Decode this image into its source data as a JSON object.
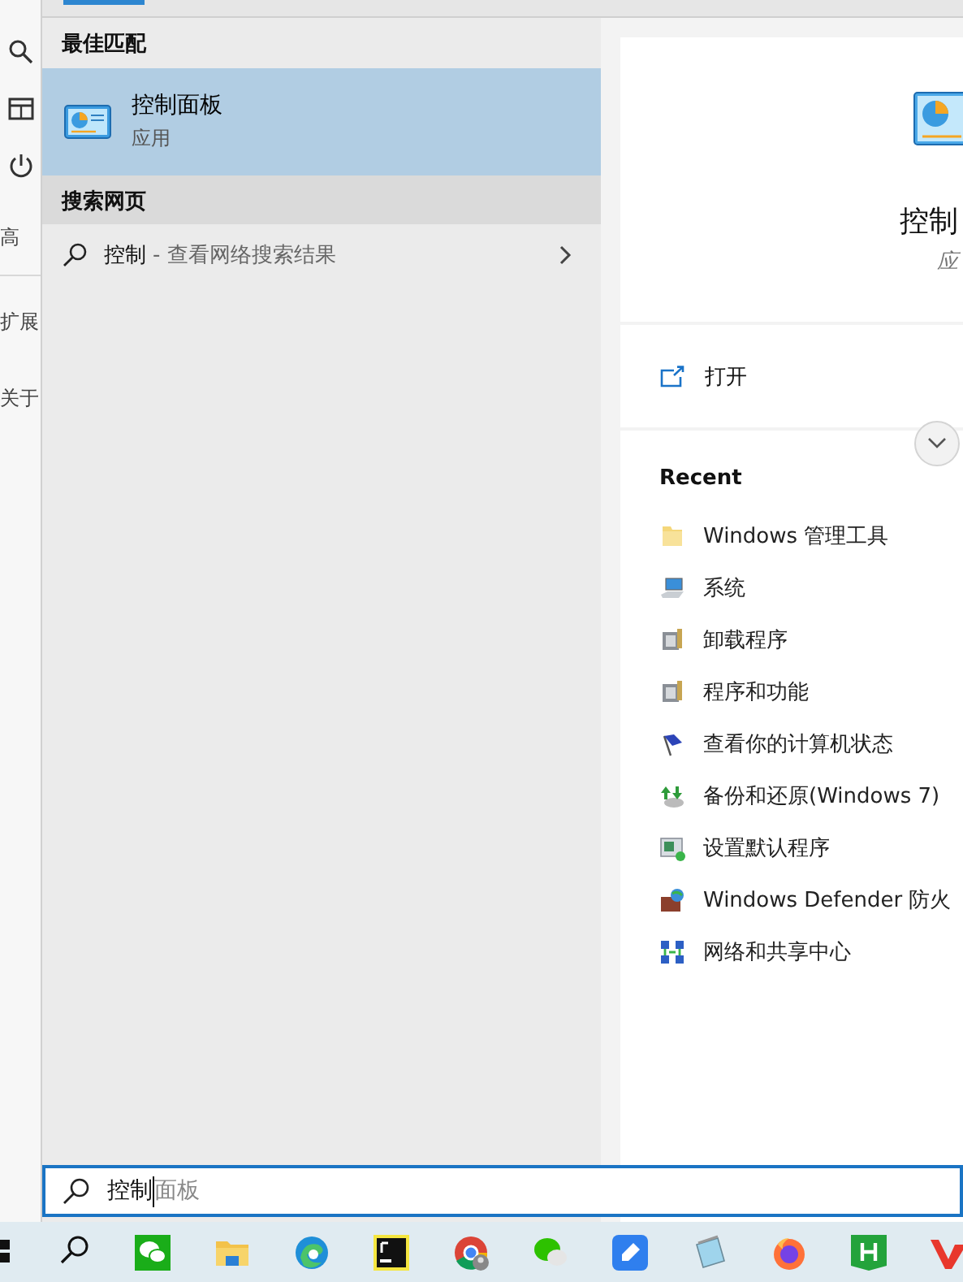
{
  "side_rail": {
    "icons": [
      {
        "kind": "search"
      },
      {
        "kind": "panel"
      },
      {
        "kind": "power"
      }
    ],
    "labels": [
      "高",
      "扩展",
      "关于"
    ]
  },
  "best_match": {
    "header": "最佳匹配",
    "item": {
      "title": "控制面板",
      "subtitle": "应用",
      "selected": true
    }
  },
  "web_search": {
    "header": "搜索网页",
    "query": "控制",
    "hint": "- 查看网络搜索结果"
  },
  "detail": {
    "title": "控制",
    "subtitle": "应",
    "open_label": "打开",
    "recent_header": "Recent",
    "recent": [
      {
        "kind": "folder",
        "label": "Windows 管理工具"
      },
      {
        "kind": "monitor",
        "label": "系统"
      },
      {
        "kind": "installer",
        "label": "卸载程序"
      },
      {
        "kind": "installer",
        "label": "程序和功能"
      },
      {
        "kind": "flag",
        "label": "查看你的计算机状态"
      },
      {
        "kind": "backup",
        "label": "备份和还原(Windows 7)"
      },
      {
        "kind": "defaults",
        "label": "设置默认程序"
      },
      {
        "kind": "firewall",
        "label": "Windows Defender 防火"
      },
      {
        "kind": "network",
        "label": "网络和共享中心"
      }
    ]
  },
  "search_box": {
    "value": "控制",
    "suggestion": "面板"
  },
  "taskbar": [
    {
      "kind": "start"
    },
    {
      "kind": "search"
    },
    {
      "kind": "wechat"
    },
    {
      "kind": "explorer"
    },
    {
      "kind": "edge"
    },
    {
      "kind": "pycharm"
    },
    {
      "kind": "chrome"
    },
    {
      "kind": "chat"
    },
    {
      "kind": "pen"
    },
    {
      "kind": "notepad"
    },
    {
      "kind": "firefox"
    },
    {
      "kind": "h"
    },
    {
      "kind": "v"
    }
  ]
}
